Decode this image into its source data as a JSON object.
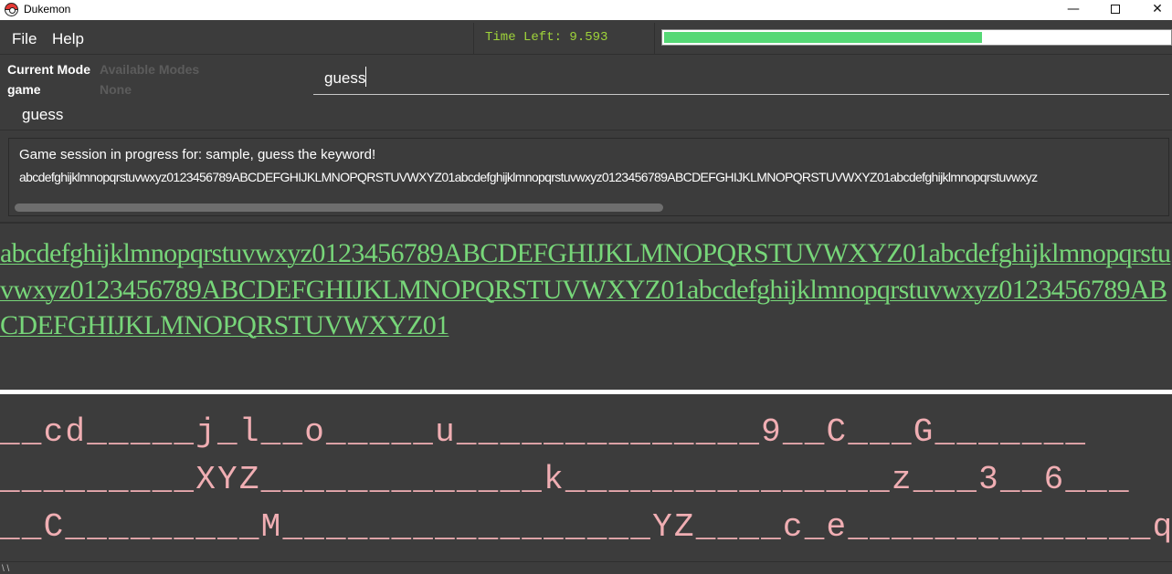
{
  "window": {
    "title": "Dukemon",
    "minimize_glyph": "—",
    "close_glyph": "✕"
  },
  "menu": {
    "file": "File",
    "help": "Help"
  },
  "timer": {
    "label": "Time Left: 9.593",
    "progress_fraction": 0.63,
    "accent_color": "#9fd43a",
    "bar_color": "#55d875"
  },
  "mode": {
    "current_label": "Current Mode",
    "current_value": "game",
    "available_label": "Available Modes",
    "available_value": "None"
  },
  "command_box": {
    "value": "guess"
  },
  "suggestion": "guess",
  "result": {
    "line1": "Game session in progress for: sample, guess the keyword!",
    "line2": "abcdefghijklmnopqrstuvwxyz0123456789ABCDEFGHIJKLMNOPQRSTUVWXYZ01abcdefghijklmnopqrstuvwxyz0123456789ABCDEFGHIJKLMNOPQRSTUVWXYZ01abcdefghijklmnopqrstuvwxyz"
  },
  "word": "abcdefghijklmnopqrstuvwxyz0123456789ABCDEFGHIJKLMNOPQRSTUVWXYZ01abcdefghijklmnopqrstuvwxyz0123456789ABCDEFGHIJKLMNOPQRSTUVWXYZ01abcdefghijklmnopqrstuvwxyz0123456789ABCDEFGHIJKLMNOPQRSTUVWXYZ01",
  "hint": {
    "line1": "__cd_____j_l__o_____u______________9__C___G_______",
    "line2": "_________XYZ_____________k_______________z___3__6___",
    "line3": "__C_________M_________________YZ____c_e______________q__...",
    "color": "#f0aeb3"
  },
  "status": "\\ \\"
}
